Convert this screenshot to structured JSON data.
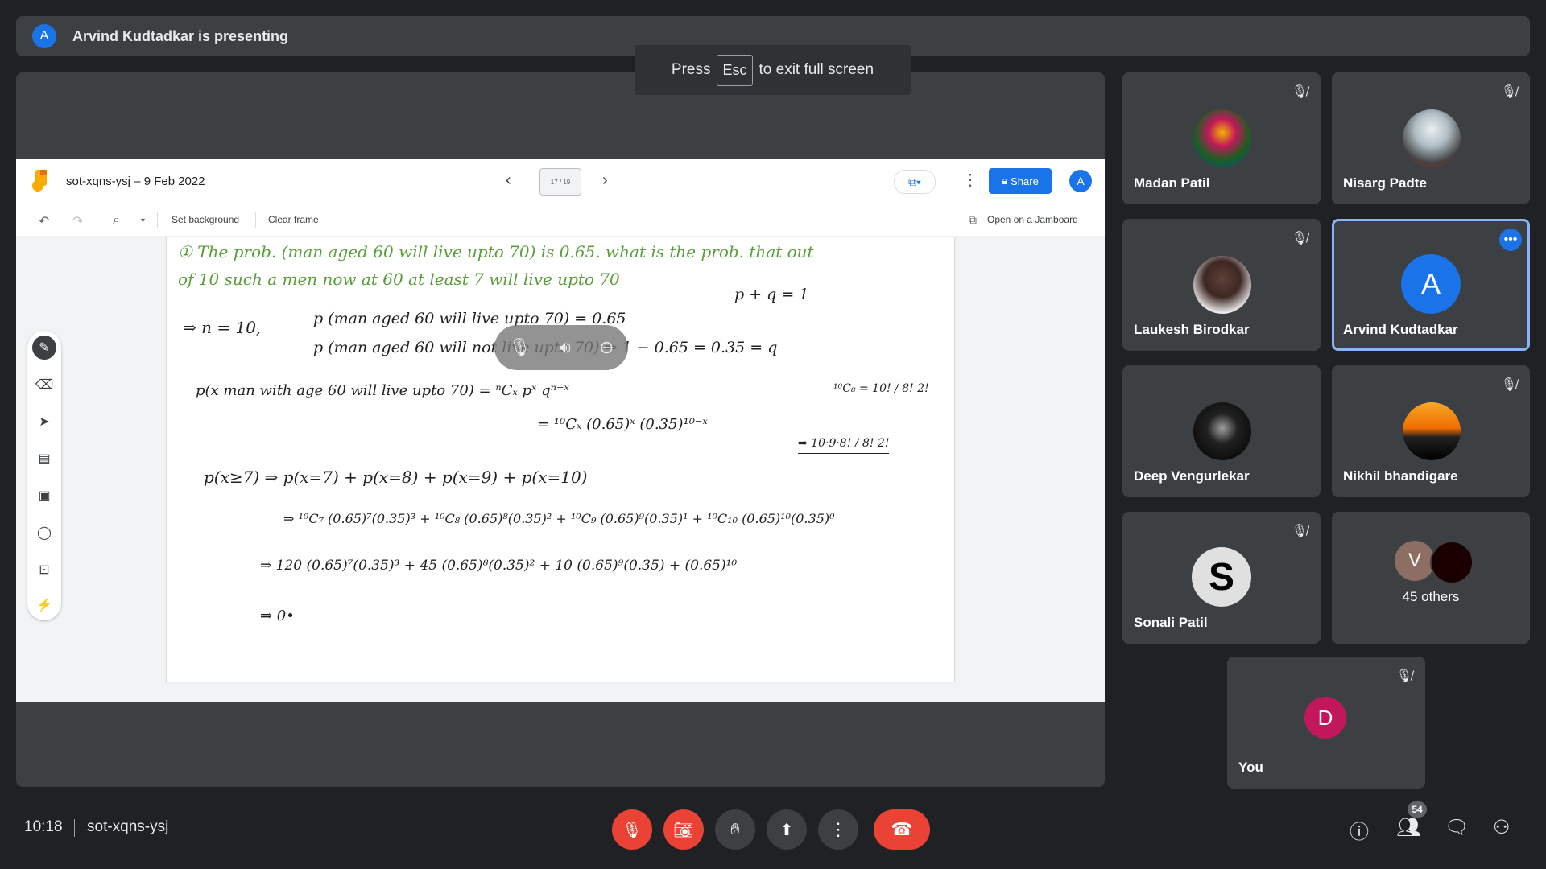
{
  "banner": {
    "avatar_letter": "A",
    "text": "Arvind Kudtadkar is presenting"
  },
  "esc_hint": {
    "pre": "Press",
    "key": "Esc",
    "post": "to exit full screen"
  },
  "jamboard": {
    "title": "sot-xqns-ysj – 9 Feb 2022",
    "frame_indicator": "17 / 19",
    "share_label": "Share",
    "avatar_letter": "A",
    "set_background": "Set background",
    "clear_frame": "Clear frame",
    "open_on_jamboard": "Open on a Jamboard",
    "handwriting": {
      "line1": "① The prob. (man aged 60 will live upto 70) is 0.65. what is the prob. that out",
      "line2": "of 10 such a men now at 60 at least 7 will live upto 70",
      "line3a": "⇒ n = 10,",
      "line3b": "p (man aged 60 will live upto 70) = 0.65",
      "line3c": "p + q = 1",
      "line4": "p (man aged 60 will not live upto 70) ⇒ 1 − 0.65 = 0.35 = q",
      "line5a": "p(x man with age 60 will live upto 70) = ⁿCₓ pˣ qⁿ⁻ˣ",
      "line5b": "= ¹⁰Cₓ (0.65)ˣ (0.35)¹⁰⁻ˣ",
      "side1": "¹⁰C₈ = 10! / 8! 2!",
      "side2": "⇒ 10·9·8! / 8! 2!",
      "line6": "p(x≥7) ⇒ p(x=7) + p(x=8) + p(x=9) + p(x=10)",
      "line7": "⇒ ¹⁰C₇ (0.65)⁷(0.35)³ + ¹⁰C₈ (0.65)⁸(0.35)² + ¹⁰C₉ (0.65)⁹(0.35)¹ + ¹⁰C₁₀ (0.65)¹⁰(0.35)⁰",
      "line8": "⇒ 120 (0.65)⁷(0.35)³ + 45 (0.65)⁸(0.35)² + 10 (0.65)⁹(0.35) + (0.65)¹⁰",
      "line9": "⇒ 0•"
    }
  },
  "participants": [
    {
      "name": "Madan Patil",
      "muted": true
    },
    {
      "name": "Nisarg Padte",
      "muted": true
    },
    {
      "name": "Laukesh Birodkar",
      "muted": true
    },
    {
      "name": "Arvind Kudtadkar",
      "letter": "A",
      "muted": false,
      "active": true
    },
    {
      "name": "Deep Vengurlekar",
      "muted": false
    },
    {
      "name": "Nikhil bhandigare",
      "muted": true
    },
    {
      "name": "Sonali Patil",
      "muted": true
    },
    {
      "name": "45 others",
      "letter": "V"
    },
    {
      "name": "You",
      "letter": "D",
      "muted": true
    }
  ],
  "footer": {
    "time": "10:18",
    "meeting_code": "sot-xqns-ysj",
    "people_count": "54"
  },
  "colors": {
    "accent": "#1a73e8",
    "danger": "#ea4335",
    "ink_green": "#5a9e3a",
    "tile_bg": "#3c4043"
  }
}
